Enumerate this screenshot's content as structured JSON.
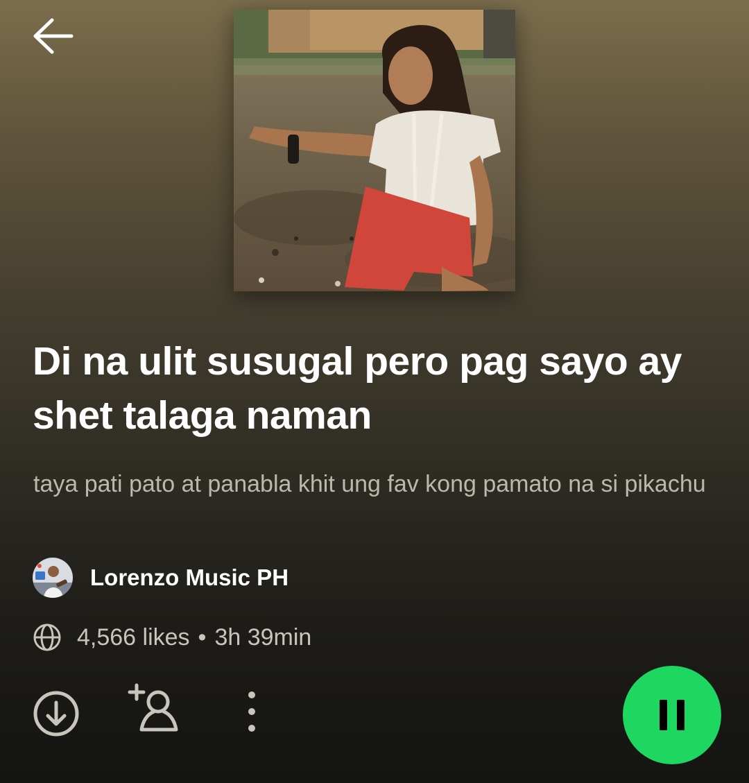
{
  "header": {
    "back_icon": "arrow-left-icon"
  },
  "playlist": {
    "title": "Di na ulit susugal pero pag sayo ay shet talaga naman",
    "description": "taya pati pato at panabla khit ung fav kong pamato na si pikachu",
    "owner": "Lorenzo Music PH",
    "likes": "4,566 likes",
    "separator": "•",
    "duration": "3h 39min"
  },
  "actions": {
    "download_icon": "download-circle-icon",
    "add_follow_icon": "add-person-icon",
    "more_icon": "more-vertical-icon",
    "play_state_icon": "pause-icon"
  },
  "colors": {
    "accent": "#1ed760",
    "gradient_top": "#7b6d4c",
    "gradient_bottom": "#141412",
    "secondary_text": "#bdb8ac"
  }
}
